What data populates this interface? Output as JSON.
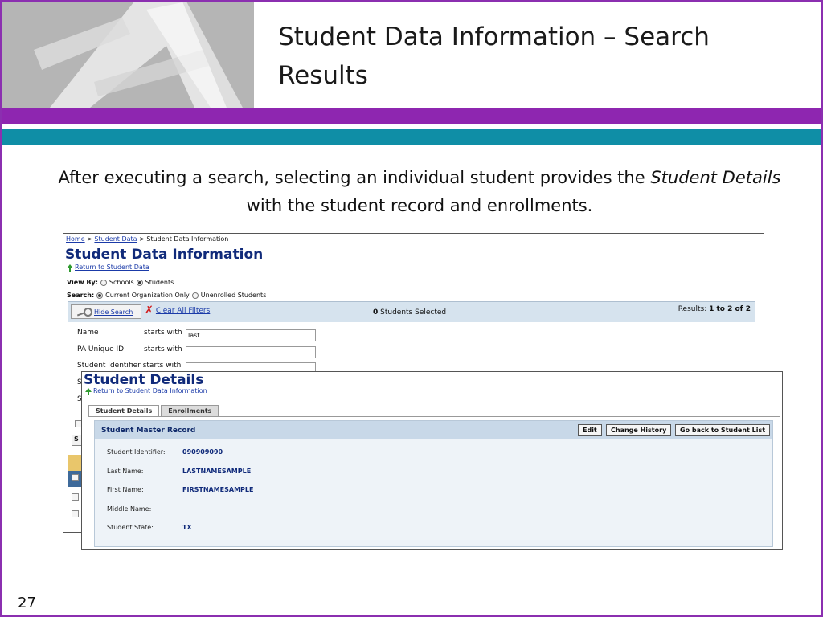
{
  "slide": {
    "title": "Student Data Information – Search Results",
    "intro_before": "After executing a search, selecting an individual student provides the ",
    "intro_emph": "Student Details",
    "intro_after": " with the student record and enrollments.",
    "page_number": "27"
  },
  "colors": {
    "purple_band": "#8e26b0",
    "teal_band": "#0f8ea6",
    "heading_navy": "#102a7a",
    "search_bar": "#d6e3ee"
  },
  "back_window": {
    "breadcrumb": {
      "home": "Home",
      "sep1": " > ",
      "student_data": "Student Data",
      "sep2": " > ",
      "current": "Student Data Information"
    },
    "heading": "Student Data Information",
    "return_link": "Return to Student Data",
    "view_by": {
      "label": "View By:",
      "options": [
        "Schools",
        "Students"
      ],
      "selected": "Students"
    },
    "search": {
      "label": "Search:",
      "options": [
        "Current Organization Only",
        "Unenrolled Students"
      ],
      "selected": "Current Organization Only"
    },
    "toolbar": {
      "hide_search": "Hide Search",
      "clear_filters": "Clear All Filters",
      "selected_count": "0",
      "selected_text": " Students Selected",
      "results_label": "Results: ",
      "results_value": "1 to 2 of 2"
    },
    "filters": [
      {
        "label": "Name",
        "op": "starts with",
        "value": "last"
      },
      {
        "label": "PA Unique ID",
        "op": "starts with",
        "value": ""
      },
      {
        "label": "Student Identifier",
        "op": "starts with",
        "value": ""
      }
    ],
    "partial_letters": [
      "S",
      "S",
      "S"
    ]
  },
  "front_window": {
    "heading": "Student Details",
    "return_link": "Return to Student Data Information",
    "tabs": [
      "Student Details",
      "Enrollments"
    ],
    "active_tab": "Student Details",
    "record_title": "Student Master Record",
    "buttons": [
      "Edit",
      "Change History",
      "Go back to Student List"
    ],
    "fields": [
      {
        "label": "Student Identifier:",
        "value": "090909090"
      },
      {
        "label": "Last Name:",
        "value": "LASTNAMESAMPLE"
      },
      {
        "label": "First Name:",
        "value": "FIRSTNAMESAMPLE"
      },
      {
        "label": "Middle Name:",
        "value": ""
      },
      {
        "label": "Student State:",
        "value": "TX"
      }
    ]
  }
}
